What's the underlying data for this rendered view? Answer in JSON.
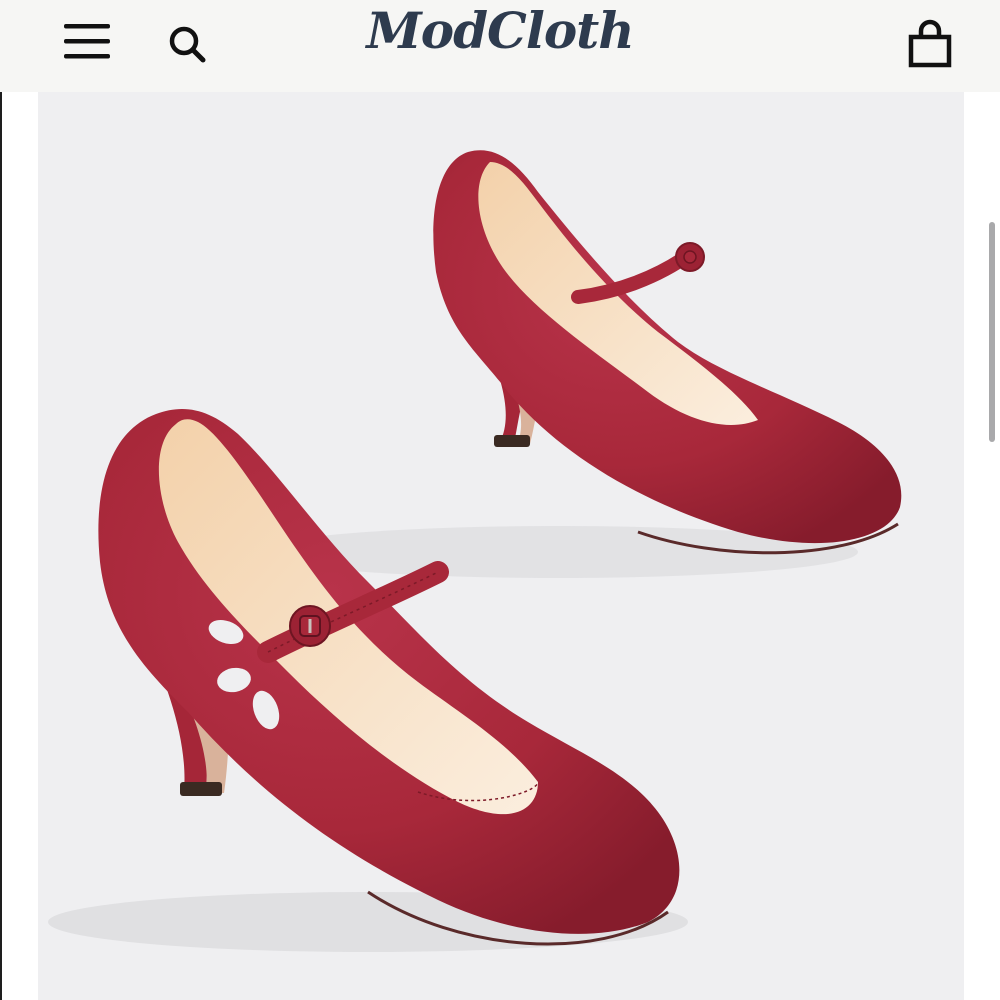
{
  "header": {
    "logo_text": "ModCloth",
    "icons": {
      "menu": "menu-icon",
      "search": "search-icon",
      "bag": "shopping-bag-icon"
    }
  },
  "product": {
    "image_subject": "red-suede-mary-jane-heels"
  },
  "colors": {
    "header_bg": "#f6f6f4",
    "logo": "#2e3b4e",
    "shoe": "#a8283a",
    "image_bg": "#efeff1"
  }
}
